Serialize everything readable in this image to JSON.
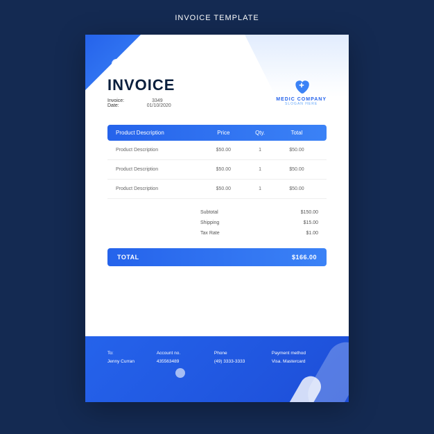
{
  "page_title": "INVOICE TEMPLATE",
  "header": {
    "title": "INVOICE",
    "invoice_label": "Invoice:",
    "invoice_no": "3349",
    "date_label": "Date:",
    "date_value": "01/10/2020"
  },
  "company": {
    "name": "MEDIC COMPANY",
    "slogan": "SLOGAN HERE"
  },
  "table": {
    "columns": [
      "Product Description",
      "Price",
      "Qty.",
      "Total"
    ],
    "rows": [
      {
        "desc": "Product Description",
        "price": "$50.00",
        "qty": "1",
        "total": "$50.00"
      },
      {
        "desc": "Product Description",
        "price": "$50.00",
        "qty": "1",
        "total": "$50.00"
      },
      {
        "desc": "Product Description",
        "price": "$50.00",
        "qty": "1",
        "total": "$50.00"
      }
    ]
  },
  "subtotals": {
    "subtotal_label": "Subtotal",
    "subtotal_value": "$150.00",
    "shipping_label": "Shipping",
    "shipping_value": "$15.00",
    "tax_label": "Tax Rate",
    "tax_value": "$1.00"
  },
  "total": {
    "label": "TOTAL",
    "value": "$166.00"
  },
  "footer": {
    "to_label": "To:",
    "to_value": "Jenny Curran",
    "account_label": "Account no.",
    "account_value": "435563489",
    "phone_label": "Phone",
    "phone_value": "(49) 3333-3333",
    "payment_label": "Payment method",
    "payment_value": "Visa. Mastercard"
  }
}
